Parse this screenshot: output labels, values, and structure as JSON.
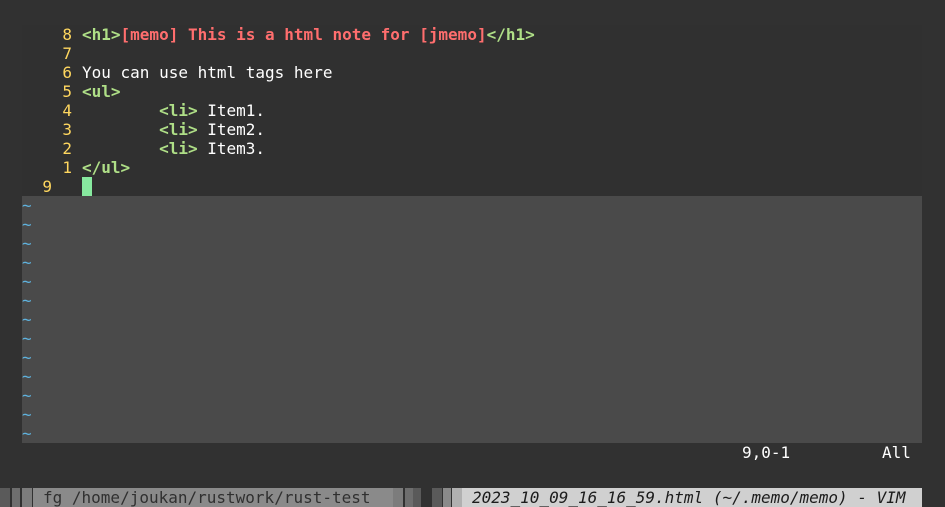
{
  "buffer": {
    "lines": [
      {
        "num": "8",
        "parts": [
          "<h1>",
          "[memo] This is a html note for [jmemo]",
          "</h1>"
        ]
      },
      {
        "num": "7",
        "parts": []
      },
      {
        "num": "6",
        "text": "You can use html tags here"
      },
      {
        "num": "5",
        "tag": "<ul>"
      },
      {
        "num": "4",
        "indent": "        ",
        "tag": "<li>",
        "text": " Item1."
      },
      {
        "num": "3",
        "indent": "        ",
        "tag": "<li>",
        "text": " Item2."
      },
      {
        "num": "2",
        "indent": "        ",
        "tag": "<li>",
        "text": " Item3."
      },
      {
        "num": "1",
        "tag": "</ul>"
      },
      {
        "num": "9"
      }
    ],
    "filler": "~"
  },
  "ruler": {
    "position": "9,0-1",
    "scroll": "All"
  },
  "tmux": {
    "inactive_window": "fg /home/joukan/rustwork/rust-test",
    "active_window": "2023_10_09_16_16_59.html (~/.memo/memo) - VIM"
  },
  "colors": {
    "background": "#313131",
    "line_number": "#ffd75f",
    "tag": "#afdf87",
    "heading_text": "#ff6e6e",
    "tilde": "#5fb3df",
    "cursor": "#87e99f"
  }
}
